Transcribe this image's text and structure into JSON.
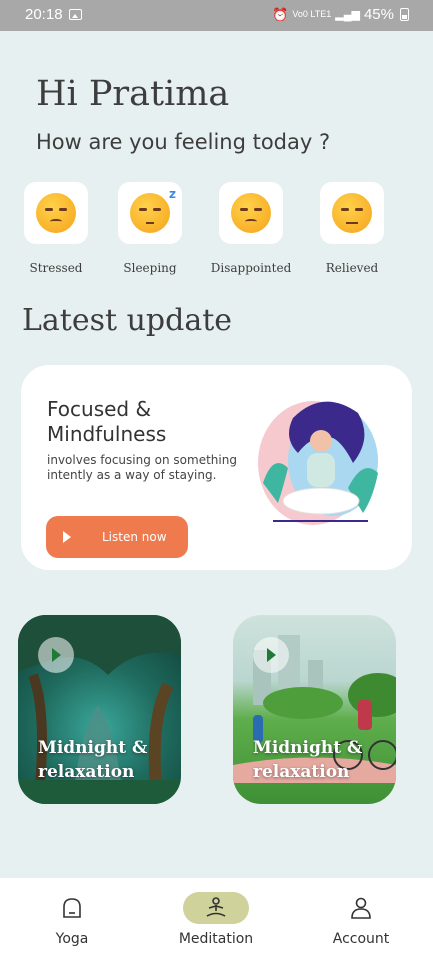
{
  "status_bar": {
    "time": "20:18",
    "network": "Vo0 LTE1",
    "battery": "45%"
  },
  "header": {
    "greeting": "Hi Pratima",
    "question": "How are you feeling today ?"
  },
  "moods": [
    {
      "label": "Stressed",
      "icon": "stressed-emoji-icon"
    },
    {
      "label": "Sleeping",
      "icon": "sleeping-emoji-icon"
    },
    {
      "label": "Disappointed",
      "icon": "disappointed-emoji-icon"
    },
    {
      "label": "Relieved",
      "icon": "relieved-emoji-icon"
    }
  ],
  "latest": {
    "section_title": "Latest update",
    "card": {
      "title": "Focused & Mindfulness",
      "description": "involves focusing on something intently as a way of staying.",
      "button_label": "Listen now",
      "accent": "#ef7a4e"
    }
  },
  "media_cards": [
    {
      "caption_line1": "Midnight &",
      "caption_line2": "relaxation",
      "scene": "forest"
    },
    {
      "caption_line1": "Midnight &",
      "caption_line2": "relaxation",
      "scene": "park"
    }
  ],
  "nav": {
    "items": [
      {
        "label": "Yoga",
        "icon": "yoga-icon"
      },
      {
        "label": "Meditation",
        "icon": "meditation-icon",
        "active": true
      },
      {
        "label": "Account",
        "icon": "account-icon"
      }
    ],
    "active_color": "#cfd29a"
  }
}
